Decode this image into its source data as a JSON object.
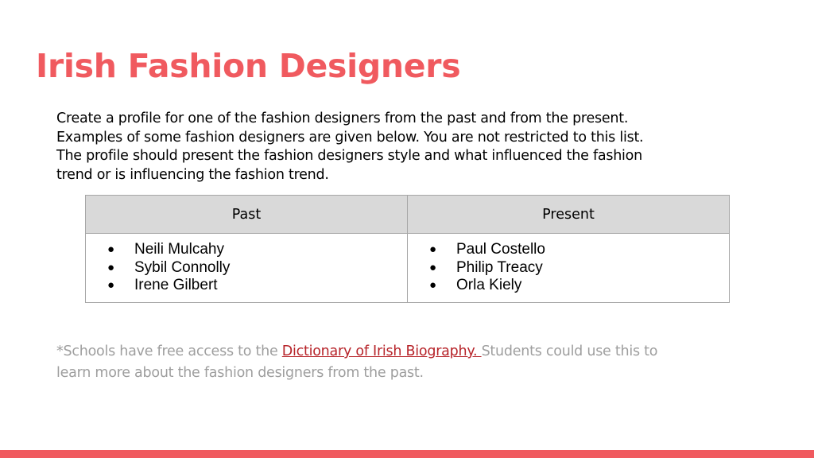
{
  "slide": {
    "title": "Irish Fashion Designers",
    "intro_lines": [
      "Create a profile for one of the fashion designers from the past and from the present.",
      "Examples of some fashion designers are given below. You are not restricted to this list.",
      "The profile should present the fashion designers style and what influenced the fashion",
      "trend or is influencing the fashion trend."
    ]
  },
  "table": {
    "headers": [
      "Past",
      "Present"
    ],
    "bullet": "●",
    "past": [
      "Neili Mulcahy",
      "Sybil Connolly",
      "Irene Gilbert"
    ],
    "present": [
      "Paul Costello",
      "Philip Treacy",
      "Orla Kiely"
    ]
  },
  "footnote": {
    "prefix": "*Schools have free access to the ",
    "link_text": "Dictionary of Irish Biography. ",
    "suffix": " Students could use this to",
    "line2": "learn more about the fashion designers from the past."
  },
  "colors": {
    "accent": "#f05a5f",
    "link": "#b7242a",
    "muted_text": "#9e9e9e"
  }
}
